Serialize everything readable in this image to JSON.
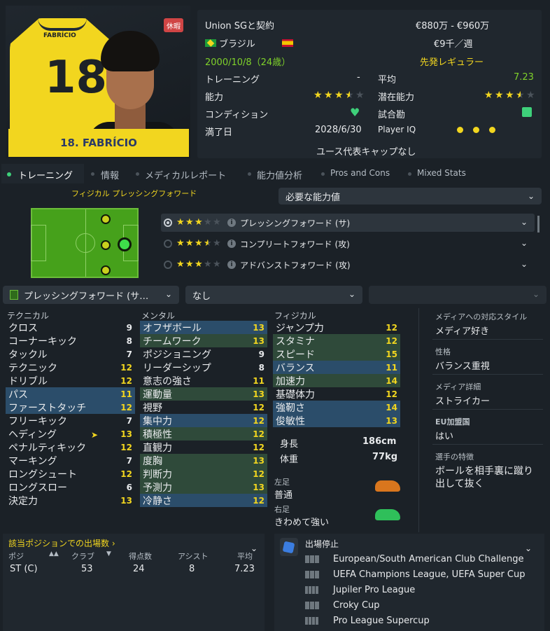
{
  "player": {
    "shirt_name": "FABRÍCIO",
    "shirt_number": "18",
    "nameplate": "18. FABRÍCIO",
    "status_badge": "休暇"
  },
  "info": {
    "contract": "Union SGと契約",
    "value_range": "€880万 - €960万",
    "nationality": "ブラジル",
    "wage": "€9千／週",
    "birth": "2000/10/8（24歳）",
    "role_status": "先発レギュラー",
    "training_label": "トレーニング",
    "training_value": "-",
    "average_label": "平均",
    "average_value": "7.23",
    "ability_label": "能力",
    "ability_stars": 3.5,
    "potential_label": "潜在能力",
    "potential_stars": 3.5,
    "condition_label": "コンディション",
    "match_fitness_label": "試合勘",
    "contract_end_label": "満了日",
    "contract_end_value": "2028/6/30",
    "player_iq_label": "Player IQ",
    "youth_caps": "ユース代表キャップなし"
  },
  "tabs": [
    "トレーニング",
    "情報",
    "メディカルレポート",
    "能力値分析",
    "Pros and Cons",
    "Mixed Stats"
  ],
  "role_header": "フィジカル  プレッシングフォワード",
  "required_attrs_dropdown": "必要な能力値",
  "roles": [
    {
      "stars": 3,
      "label": "プレッシングフォワード (サ)"
    },
    {
      "stars": 3.5,
      "label": "コンプリートフォワード (攻)"
    },
    {
      "stars": 3,
      "label": "アドバンストフォワード (攻)"
    }
  ],
  "selectors": {
    "role_select": "プレッシングフォワード (サ…",
    "duty_select": "なし",
    "third_select": ""
  },
  "technical": {
    "header": "テクニカル",
    "items": [
      {
        "name": "クロス",
        "value": "9"
      },
      {
        "name": "コーナーキック",
        "value": "8"
      },
      {
        "name": "タックル",
        "value": "7"
      },
      {
        "name": "テクニック",
        "value": "12"
      },
      {
        "name": "ドリブル",
        "value": "12"
      },
      {
        "name": "パス",
        "value": "11"
      },
      {
        "name": "ファーストタッチ",
        "value": "12"
      },
      {
        "name": "フリーキック",
        "value": "7"
      },
      {
        "name": "ヘディング",
        "value": "13"
      },
      {
        "name": "ペナルティキック",
        "value": "12"
      },
      {
        "name": "マーキング",
        "value": "7"
      },
      {
        "name": "ロングシュート",
        "value": "12"
      },
      {
        "name": "ロングスロー",
        "value": "6"
      },
      {
        "name": "決定力",
        "value": "13"
      }
    ]
  },
  "mental": {
    "header": "メンタル",
    "items": [
      {
        "name": "オフザボール",
        "value": "13"
      },
      {
        "name": "チームワーク",
        "value": "13"
      },
      {
        "name": "ポジショニング",
        "value": "9"
      },
      {
        "name": "リーダーシップ",
        "value": "8"
      },
      {
        "name": "意志の強さ",
        "value": "11"
      },
      {
        "name": "運動量",
        "value": "13"
      },
      {
        "name": "視野",
        "value": "12"
      },
      {
        "name": "集中力",
        "value": "12"
      },
      {
        "name": "積極性",
        "value": "12"
      },
      {
        "name": "直観力",
        "value": "12"
      },
      {
        "name": "度胸",
        "value": "13"
      },
      {
        "name": "判断力",
        "value": "12"
      },
      {
        "name": "予測力",
        "value": "13"
      },
      {
        "name": "冷静さ",
        "value": "12"
      }
    ]
  },
  "physical": {
    "header": "フィジカル",
    "items": [
      {
        "name": "ジャンプ力",
        "value": "12"
      },
      {
        "name": "スタミナ",
        "value": "12"
      },
      {
        "name": "スピード",
        "value": "15"
      },
      {
        "name": "バランス",
        "value": "11"
      },
      {
        "name": "加速力",
        "value": "14"
      },
      {
        "name": "基礎体力",
        "value": "12"
      },
      {
        "name": "強靭さ",
        "value": "14"
      },
      {
        "name": "俊敏性",
        "value": "13"
      }
    ]
  },
  "body": {
    "height_label": "身長",
    "height_value": "186cm",
    "weight_label": "体重",
    "weight_value": "77kg",
    "left_foot_label": "左足",
    "left_foot_value": "普通",
    "right_foot_label": "右足",
    "right_foot_value": "きわめて強い"
  },
  "side": {
    "media_style_label": "メディアへの対応スタイル",
    "media_style_value": "メディア好き",
    "personality_label": "性格",
    "personality_value": "バランス重視",
    "media_detail_label": "メディア詳細",
    "media_detail_value": "ストライカー",
    "eu_label": "EU加盟国",
    "eu_value": "はい",
    "traits_label": "選手の特徴",
    "traits_value": "ボールを相手裏に蹴り出して抜く"
  },
  "appearances": {
    "title": "該当ポジションでの出場数",
    "headers": [
      "ポジ",
      "クラブ",
      "得点数",
      "アシスト",
      "平均"
    ],
    "row": [
      "ST (C)",
      "53",
      "24",
      "8",
      "7.23"
    ]
  },
  "suspension": {
    "title": "出場停止",
    "items": [
      "European/South American Club Challenge",
      "UEFA Champions League, UEFA Super Cup",
      "Jupiler Pro League",
      "Croky Cup",
      "Pro League Supercup"
    ]
  },
  "colors": {
    "accent_yellow": "#f2d61f",
    "accent_green": "#7fd22a",
    "background": "#1b2127"
  }
}
